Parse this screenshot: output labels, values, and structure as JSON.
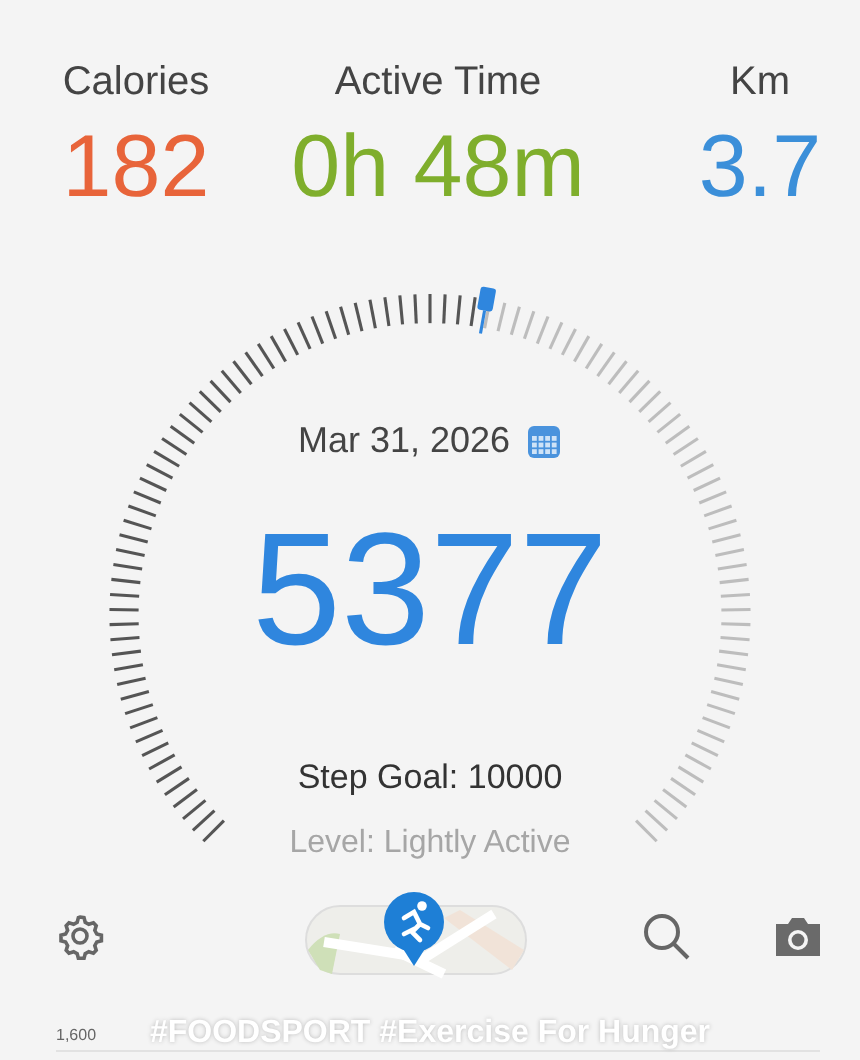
{
  "stats": [
    {
      "label": "Calories",
      "value": "182",
      "color": "#e8643a"
    },
    {
      "label": "Active Time",
      "value": "0h 48m",
      "color": "#7fae2c"
    },
    {
      "label": "Km",
      "value": "3.7",
      "color": "#3b8fd9"
    }
  ],
  "gauge": {
    "date": "Mar 31, 2026",
    "steps": "5377",
    "goal": "Step Goal: 10000",
    "activity_level": "Level: Lightly Active"
  },
  "banner": {
    "text": "#FOODSPORT #Exercise For Hunger",
    "axis_label": "1,600"
  }
}
